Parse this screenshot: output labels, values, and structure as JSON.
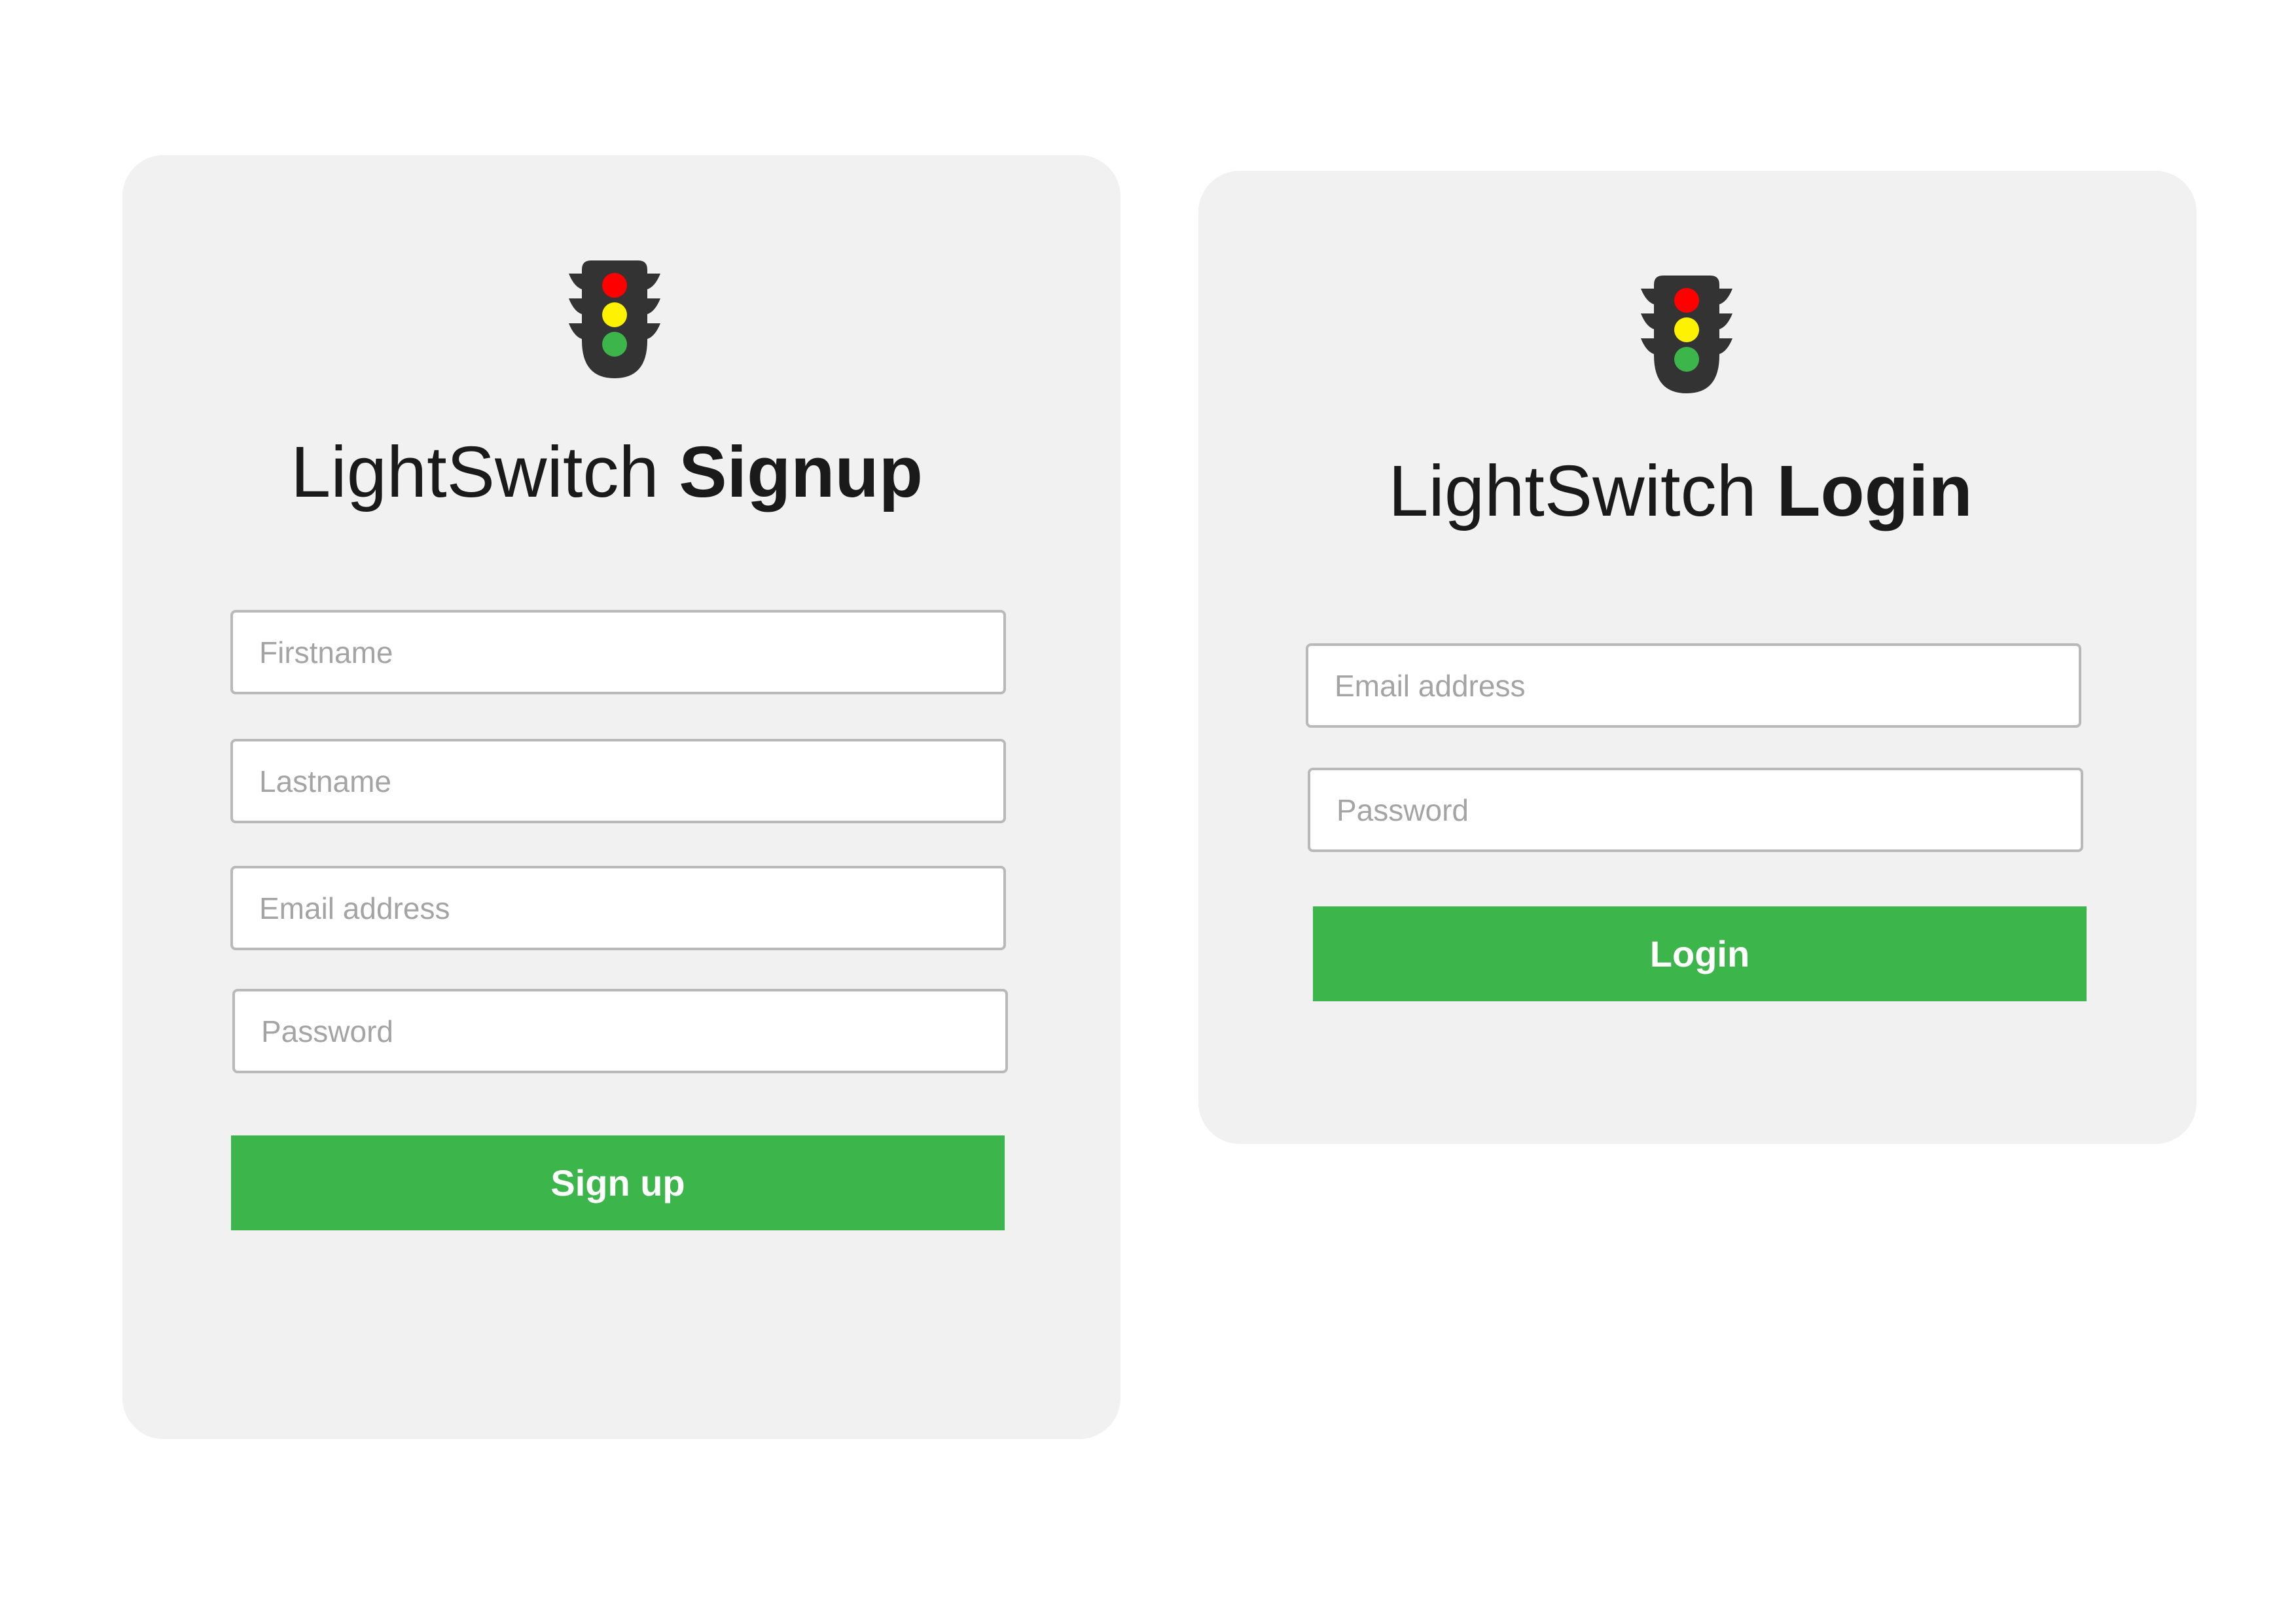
{
  "colors": {
    "page_background": "#ffffff",
    "card_background": "#f1f1f1",
    "accent_green": "#3cb54b",
    "field_border": "#b9b9b9",
    "placeholder": "#a4a4a4",
    "title_text": "#1a1a1a",
    "traffic_light_body": "#333333",
    "light_red": "#ff0000",
    "light_yellow": "#fff200",
    "light_green": "#3cb54b"
  },
  "signup": {
    "logo_icon": "traffic-light-icon",
    "title_light": "LightSwitch ",
    "title_strong": "Signup",
    "firstname_placeholder": "Firstname",
    "lastname_placeholder": "Lastname",
    "email_placeholder": "Email address",
    "password_placeholder": "Password",
    "submit_label": "Sign up"
  },
  "login": {
    "logo_icon": "traffic-light-icon",
    "title_light": "LightSwitch ",
    "title_strong": "Login",
    "email_placeholder": "Email address",
    "password_placeholder": "Password",
    "submit_label": "Login"
  }
}
